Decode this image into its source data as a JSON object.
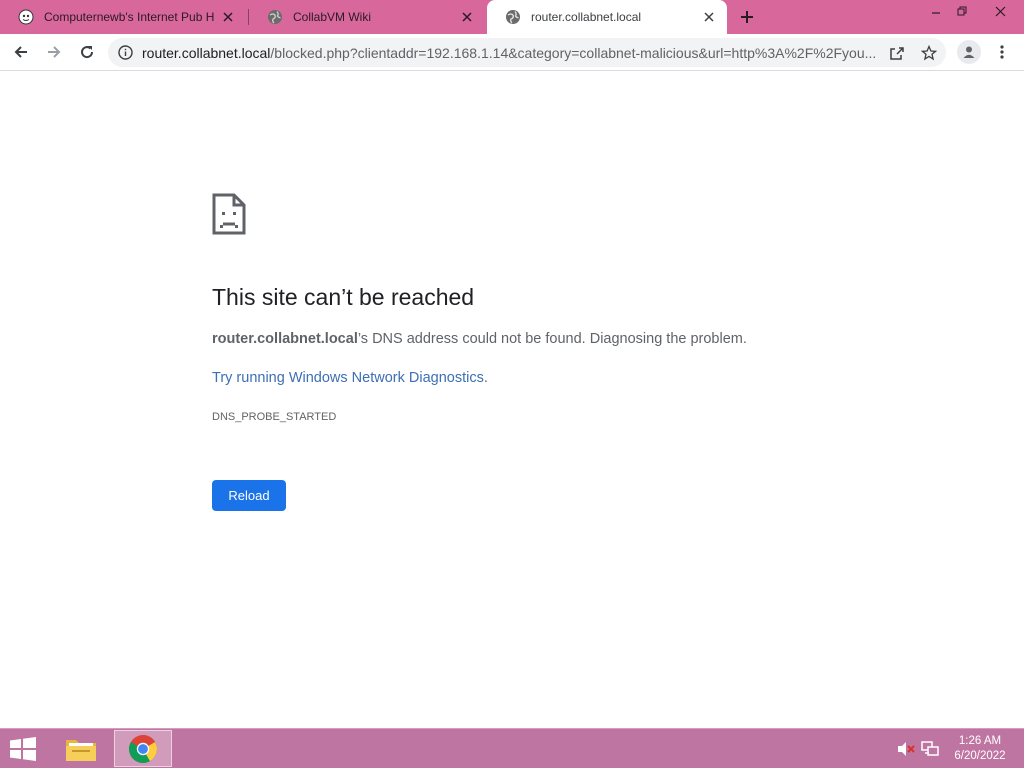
{
  "browser": {
    "tabs": [
      {
        "title": "Computernewb's Internet Pub H",
        "favicon": "computernewb-icon",
        "active": false
      },
      {
        "title": "CollabVM Wiki",
        "favicon": "globe-icon",
        "active": false
      },
      {
        "title": "router.collabnet.local",
        "favicon": "globe-icon",
        "active": true
      }
    ],
    "address": {
      "host": "router.collabnet.local",
      "rest": "/blocked.php?clientaddr=192.168.1.14&category=collabnet-malicious&url=http%3A%2F%2Fyou..."
    }
  },
  "error_page": {
    "title": "This site can’t be reached",
    "host": "router.collabnet.local",
    "description_rest": "’s DNS address could not be found. Diagnosing the problem.",
    "link_text": "Try running Windows Network Diagnostics",
    "link_suffix": ".",
    "error_code": "DNS_PROBE_STARTED",
    "reload_label": "Reload"
  },
  "taskbar": {
    "clock_time": "1:26 AM",
    "clock_date": "6/20/2022"
  },
  "colors": {
    "tabstrip": "#d8679c",
    "taskbar": "#bf75a2",
    "accent": "#1a73e8"
  }
}
